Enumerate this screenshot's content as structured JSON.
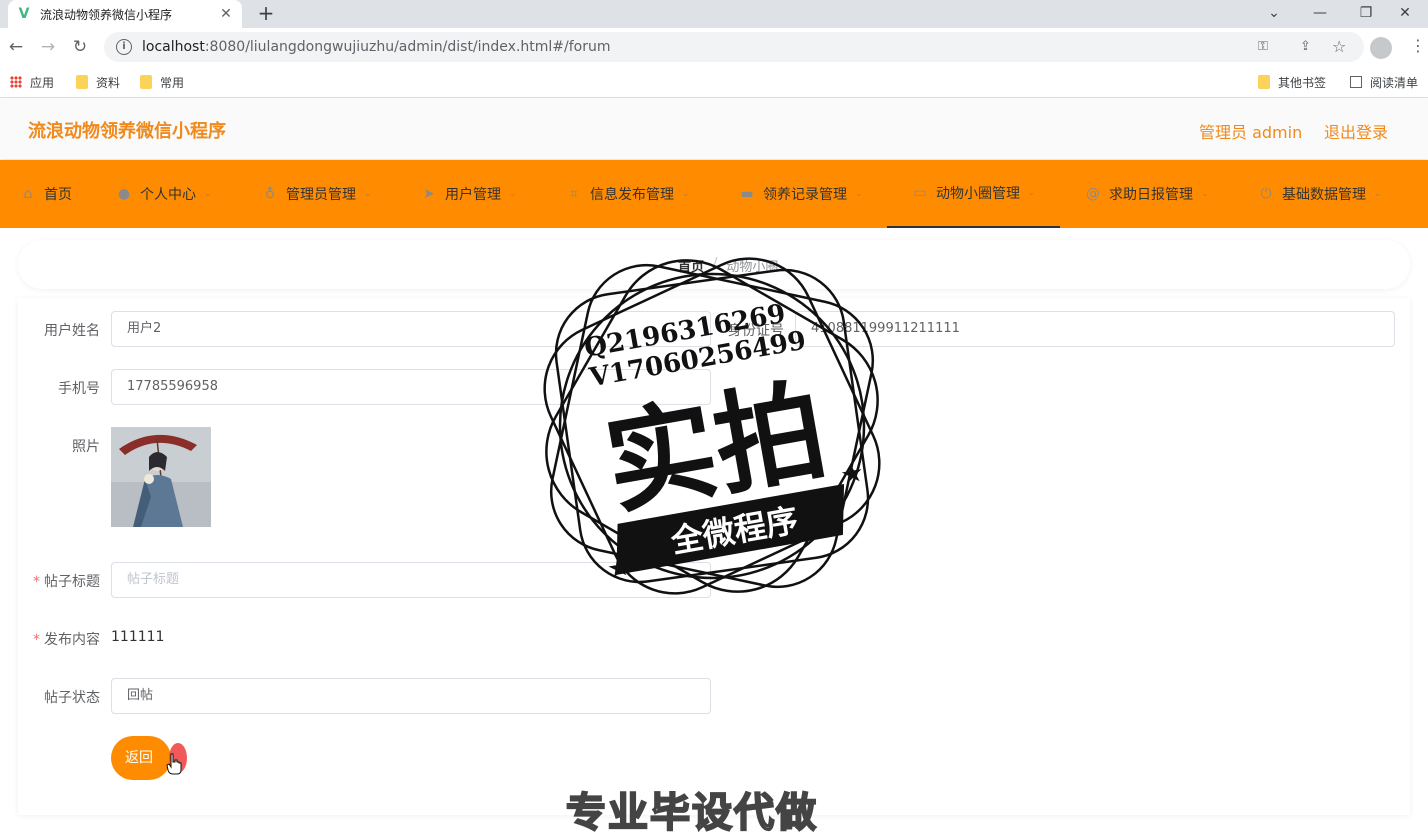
{
  "browser": {
    "tab_title": "流浪动物领养微信小程序",
    "url_host": "localhost",
    "url_path": ":8080/liulangdongwujiuzhu/admin/dist/index.html#/forum",
    "bookmarks": [
      "应用",
      "资料",
      "常用"
    ],
    "bookmarks_right": [
      "其他书签",
      "阅读清单"
    ]
  },
  "header": {
    "title": "流浪动物领养微信小程序",
    "user_label": "管理员 admin",
    "logout_label": "退出登录"
  },
  "nav": {
    "items": [
      {
        "label": "首页",
        "icon": "home-icon"
      },
      {
        "label": "个人中心",
        "icon": "user-icon"
      },
      {
        "label": "管理员管理",
        "icon": "microphone-icon"
      },
      {
        "label": "用户管理",
        "icon": "send-icon"
      },
      {
        "label": "信息发布管理",
        "icon": "crop-icon"
      },
      {
        "label": "领养记录管理",
        "icon": "monitor-icon"
      },
      {
        "label": "动物小圈管理",
        "icon": "chat-icon",
        "active": true
      },
      {
        "label": "求助日报管理",
        "icon": "at-icon"
      },
      {
        "label": "基础数据管理",
        "icon": "power-icon"
      }
    ]
  },
  "breadcrumb": {
    "home": "首页",
    "separator": "/",
    "current": "动物小圈"
  },
  "form": {
    "username_label": "用户姓名",
    "username_value": "用户2",
    "idcard_label": "身份证号",
    "idcard_value": "410881199911211111",
    "phone_label": "手机号",
    "phone_value": "17785596958",
    "photo_label": "照片",
    "post_title_label": "帖子标题",
    "post_title_placeholder": "帖子标题",
    "content_label": "发布内容",
    "content_value": "111111",
    "status_label": "帖子状态",
    "status_value": "回帖",
    "back_button": "返回"
  },
  "watermark": {
    "line1": "Q2196316269",
    "line2": "V17060256499",
    "big": "实拍",
    "banner": "全微程序",
    "bottom": "专业毕设代做"
  },
  "colors": {
    "accent": "#ff8c00",
    "title": "#f08a1c"
  }
}
